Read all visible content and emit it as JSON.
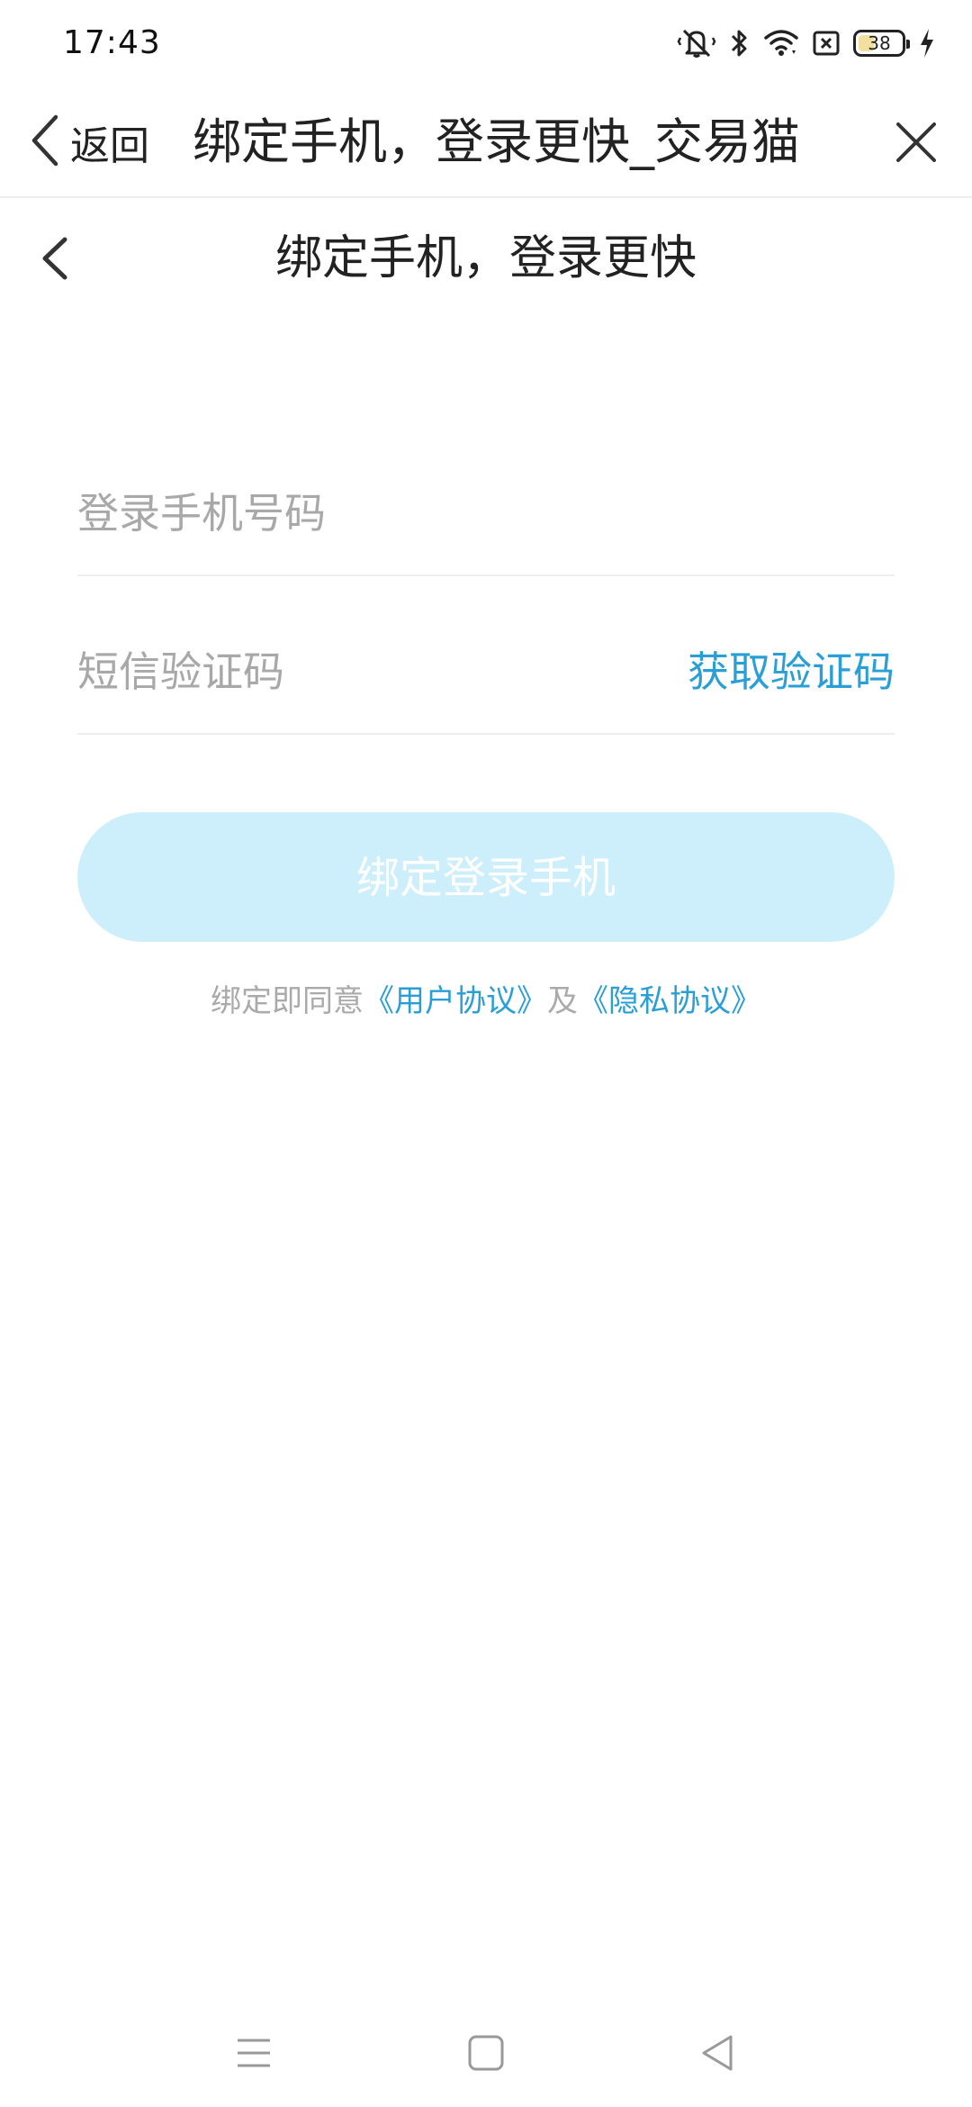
{
  "status_bar": {
    "time": "17:43",
    "battery": "38",
    "battery_level_percent": 38,
    "icons": [
      "vibrate-mute-icon",
      "bluetooth-icon",
      "wifi-icon",
      "sim-disabled-icon",
      "battery-icon",
      "charging-icon"
    ]
  },
  "titlebar": {
    "back_label": "返回",
    "title": "绑定手机，登录更快_交易猫",
    "back_icon": "chevron-left-icon",
    "close_icon": "close-icon"
  },
  "page": {
    "title": "绑定手机，登录更快",
    "back_icon": "chevron-left-icon"
  },
  "form": {
    "phone_placeholder": "登录手机号码",
    "phone_value": "",
    "sms_placeholder": "短信验证码",
    "sms_value": "",
    "get_code_label": "获取验证码",
    "submit_label": "绑定登录手机"
  },
  "agreement": {
    "prefix": "绑定即同意",
    "user_agreement": "《用户协议》",
    "conjunction": "及",
    "privacy_agreement": "《隐私协议》"
  },
  "nav_bar": {
    "icons": [
      "menu-icon",
      "home-icon",
      "back-triangle-icon"
    ]
  },
  "colors": {
    "accent": "#2a9fd6",
    "button_disabled_bg": "#cdeefb",
    "placeholder": "#a8a8a8",
    "divider": "#eeeeee",
    "text": "#222222"
  }
}
